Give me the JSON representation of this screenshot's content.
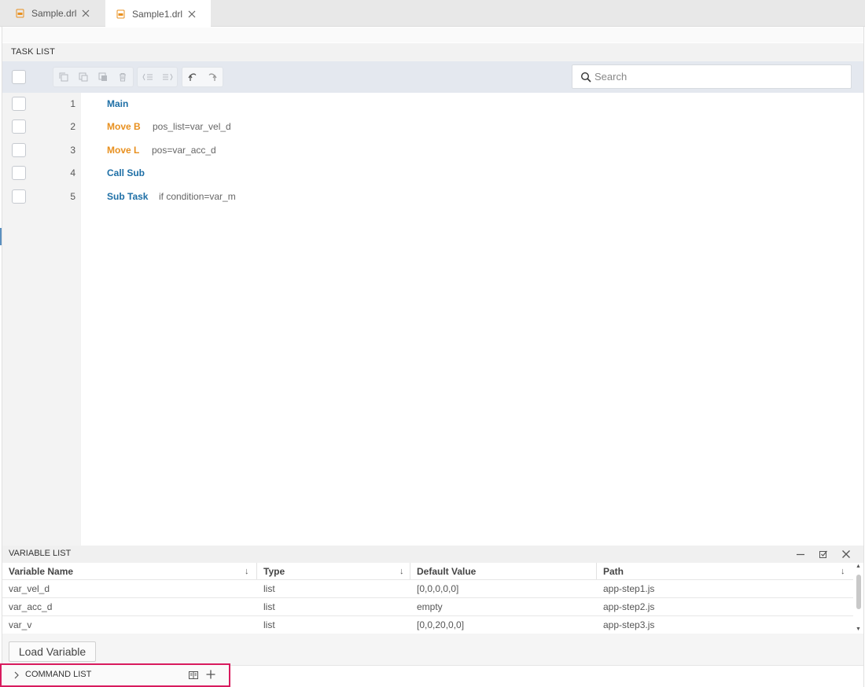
{
  "tabs": [
    {
      "label": "Sample.drl"
    },
    {
      "label": "Sample1.drl"
    }
  ],
  "task_list": {
    "title": "TASK LIST",
    "search_placeholder": "Search",
    "rows": [
      {
        "num": "1",
        "command": "Main",
        "param": "",
        "color": "#1e6fa6"
      },
      {
        "num": "2",
        "command": "Move B",
        "param": "pos_list=var_vel_d",
        "color": "#e8901f"
      },
      {
        "num": "3",
        "command": "Move L",
        "param": "pos=var_acc_d",
        "color": "#e8901f"
      },
      {
        "num": "4",
        "command": "Call Sub",
        "param": "",
        "color": "#1e6fa6"
      },
      {
        "num": "5",
        "command": "Sub Task",
        "param": "if condition=var_m",
        "color": "#1e6fa6"
      }
    ]
  },
  "variable_list": {
    "title": "VARIABLE LIST",
    "columns": [
      "Variable Name",
      "Type",
      "Default Value",
      "Path"
    ],
    "rows": [
      [
        "var_vel_d",
        "list",
        "[0,0,0,0,0]",
        "app-step1.js"
      ],
      [
        "var_acc_d",
        "list",
        "empty",
        "app-step2.js"
      ],
      [
        "var_v",
        "list",
        "[0,0,20,0,0]",
        "app-step3.js"
      ]
    ],
    "load_button": "Load Variable"
  },
  "command_list": {
    "title": "COMMAND LIST"
  },
  "colors": {
    "accent_blue": "#1e6fa6",
    "accent_orange": "#e8901f",
    "highlight": "#d81b5e"
  }
}
